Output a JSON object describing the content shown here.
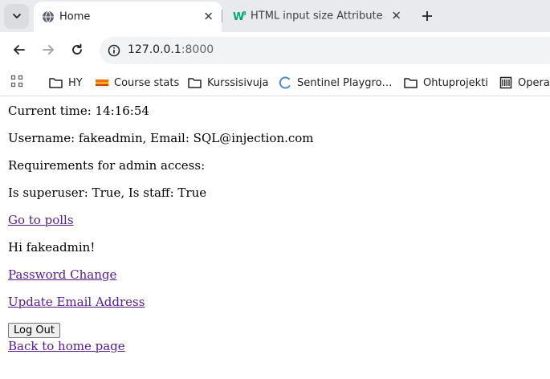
{
  "browser": {
    "tabs": [
      {
        "title": "Home",
        "active": true,
        "favicon": "globe-icon"
      },
      {
        "title": "HTML input size Attribute",
        "active": false,
        "favicon": "w3schools-icon"
      }
    ],
    "url": {
      "host": "127.0.0.1",
      "port": ":8000"
    },
    "bookmarks": [
      {
        "label": "HY",
        "icon": "folder-icon"
      },
      {
        "label": "Course stats",
        "icon": "course-stats-icon"
      },
      {
        "label": "Kurssisivuja",
        "icon": "folder-icon"
      },
      {
        "label": "Sentinel Playgro…",
        "icon": "sentinel-icon"
      },
      {
        "label": "Ohtuprojekti",
        "icon": "folder-icon"
      },
      {
        "label": "Operat",
        "icon": "bank-icon"
      }
    ]
  },
  "page": {
    "current_time": "Current time: 14:16:54",
    "user_info": "Username: fakeadmin, Email: SQL@injection.com",
    "requirements": "Requirements for admin access:",
    "flags": "Is superuser: True, Is staff: True",
    "polls_link": "Go to polls",
    "greeting": "Hi fakeadmin!",
    "password_link": "Password Change",
    "email_link": "Update Email Address",
    "logout_button": "Log Out",
    "home_link": "Back to home page"
  },
  "colors": {
    "link": "#551a8b",
    "tabstrip": "#e8eaed",
    "omnibox": "#f1f3f4"
  }
}
